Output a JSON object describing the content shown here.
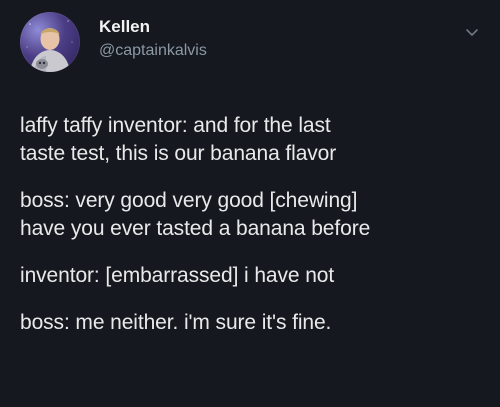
{
  "author": {
    "name": "Kellen",
    "handle": "@captainkalvis"
  },
  "tweet": {
    "paragraphs": [
      [
        "laffy taffy inventor: and for the last",
        "taste test, this is our banana flavor"
      ],
      [
        "boss: very good very good [chewing]",
        "have you ever tasted a banana before"
      ],
      [
        "inventor: [embarrassed] i have not"
      ],
      [
        "boss: me neither. i'm sure it's fine."
      ]
    ]
  },
  "icons": {
    "menu": "chevron-down-icon",
    "avatar": "profile-photo"
  },
  "colors": {
    "background": "#15181e",
    "text": "#e8e9ea",
    "secondary_text": "#8b98a5"
  }
}
